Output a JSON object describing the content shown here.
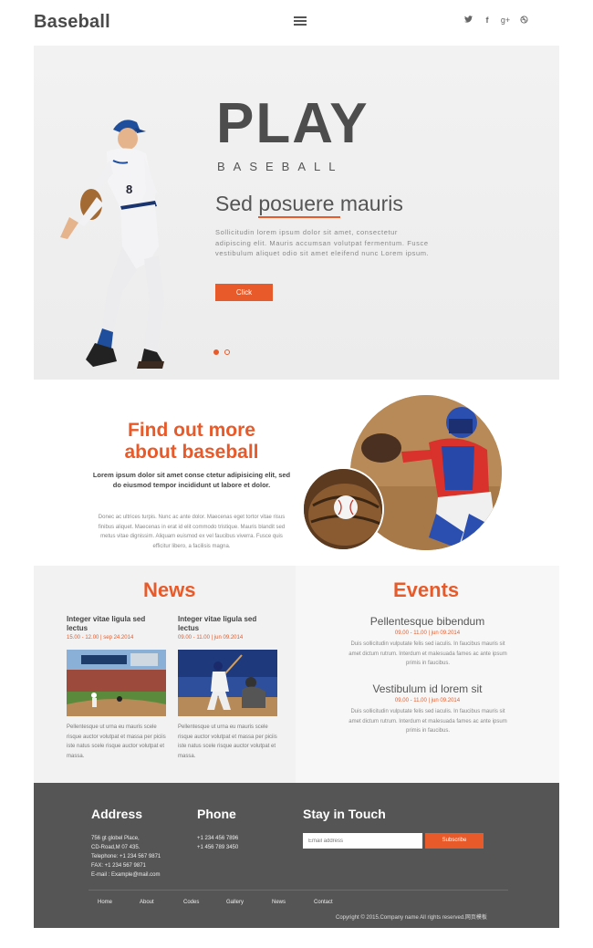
{
  "header": {
    "logo": "Baseball",
    "social": [
      "🐦",
      "f",
      "g+",
      "◎"
    ]
  },
  "hero": {
    "title": "PLAY",
    "subtitle": "BASEBALL",
    "heading": "Sed posuere mauris",
    "text": "Sollicitudin lorem ipsum dolor sit amet, consectetur adipiscing elit. Mauris accumsan volutpat fermentum. Fusce vestibulum aliquet odio sit amet eleifend nunc Lorem ipsum.",
    "button": "Click"
  },
  "about": {
    "heading_line1": "Find out more",
    "heading_line2": "about baseball",
    "bold_text": "Lorem ipsum dolor sit amet conse ctetur adipisicing elit, sed do eiusmod tempor incididunt ut labore et dolor.",
    "text": "Donec ac ultrices turpis. Nunc ac ante dolor. Maecenas eget tortor vitae risus finibus aliquet. Maecenas in erat id elit commodo tristique. Mauris blandit sed metus vitae dignissim. Aliquam euismod ex vel faucibus viverra. Fusce quis efficitur libero, a facilisis magna."
  },
  "news": {
    "title": "News",
    "items": [
      {
        "title": "Integer vitae ligula sed lectus",
        "date": "15.00 - 12.00  |  sep 24.2014",
        "text": "Pellentesque ut urna eu mauris scele risque auctor volutpat et massa per piciis iste natus scele risque auctor volutpat et massa."
      },
      {
        "title": "Integer vitae ligula sed lectus",
        "date": "09.00 - 11.00  |  jun 09.2014",
        "text": "Pellentesque ut urna eu mauris scele risque auctor volutpat et massa per piciis iste natus scele risque auctor volutpat et massa."
      }
    ]
  },
  "events": {
    "title": "Events",
    "items": [
      {
        "title": "Pellentesque bibendum",
        "date": "09.00 - 11.00  |  jun 09.2014",
        "text": "Duis sollicitudin vulputate felis sed iaculis. In faucibus mauris sit amet dictum rutrum. Interdum et malesuada fames ac ante ipsum primis in faucibus."
      },
      {
        "title": "Vestibulum id lorem sit",
        "date": "09.00 - 11.00  |  jun 09.2014",
        "text": "Duis sollicitudin vulputate felis sed iaculis. In faucibus mauris sit amet dictum rutrum. Interdum et malesuada fames ac ante ipsum primis in faucibus."
      }
    ]
  },
  "footer": {
    "address_title": "Address",
    "address_lines": [
      "756 gt globel Place,",
      "CD-Road,M 07 435.",
      "Telephone: +1 234 567 9871",
      "FAX: +1 234 567 9871",
      "E-mail : Example@mail.com"
    ],
    "phone_title": "Phone",
    "phone_lines": [
      "+1 234 456 7896",
      "+1 456 789 3450"
    ],
    "stay_title": "Stay in Touch",
    "email_placeholder": "Email address",
    "subscribe": "Subscribe",
    "nav": [
      "Home",
      "About",
      "Codes",
      "Gallery",
      "News",
      "Contact"
    ],
    "copyright": "Copyright © 2015.Company name All rights reserved.网页模板"
  },
  "colors": {
    "accent": "#e85a29",
    "footer_bg": "#555555",
    "panel_bg": "#f2f2f2"
  }
}
